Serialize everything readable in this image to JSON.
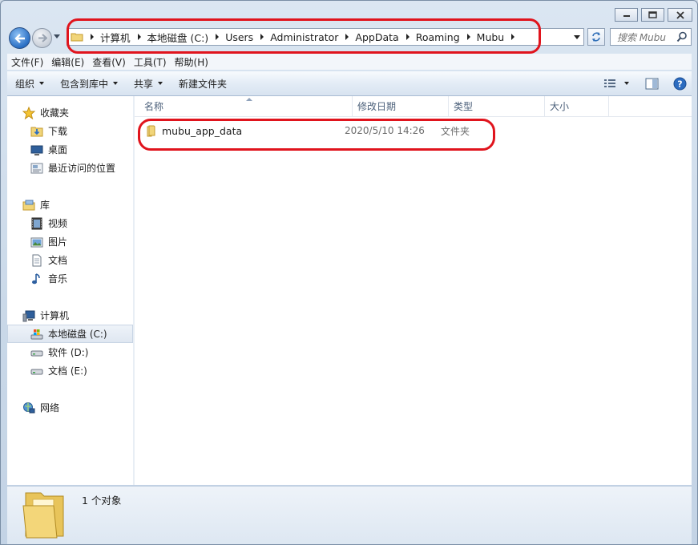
{
  "window": {
    "caption_buttons": [
      "minimize",
      "maximize",
      "close"
    ]
  },
  "nav": {
    "breadcrumbs": [
      "计算机",
      "本地磁盘 (C:)",
      "Users",
      "Administrator",
      "AppData",
      "Roaming",
      "Mubu"
    ],
    "search_placeholder": "搜索 Mubu"
  },
  "menubar": [
    "文件(F)",
    "编辑(E)",
    "查看(V)",
    "工具(T)",
    "帮助(H)"
  ],
  "commandbar": {
    "organize": "组织",
    "include_library": "包含到库中",
    "share": "共享",
    "new_folder": "新建文件夹"
  },
  "sidebar": {
    "favorites": {
      "label": "收藏夹",
      "items": [
        "下载",
        "桌面",
        "最近访问的位置"
      ]
    },
    "libraries": {
      "label": "库",
      "items": [
        "视频",
        "图片",
        "文档",
        "音乐"
      ]
    },
    "computer": {
      "label": "计算机",
      "items": [
        "本地磁盘 (C:)",
        "软件 (D:)",
        "文档 (E:)"
      ],
      "selected": "本地磁盘 (C:)"
    },
    "network": {
      "label": "网络"
    }
  },
  "columns": {
    "name": "名称",
    "date": "修改日期",
    "type": "类型",
    "size": "大小"
  },
  "files": [
    {
      "name": "mubu_app_data",
      "date": "2020/5/10 14:26",
      "type": "文件夹",
      "size": ""
    }
  ],
  "details": {
    "count_text": "1 个对象"
  },
  "colors": {
    "highlight_annotation": "#e0141d",
    "window_frame": "#c9d8e8",
    "accent": "#2a6fc4"
  }
}
